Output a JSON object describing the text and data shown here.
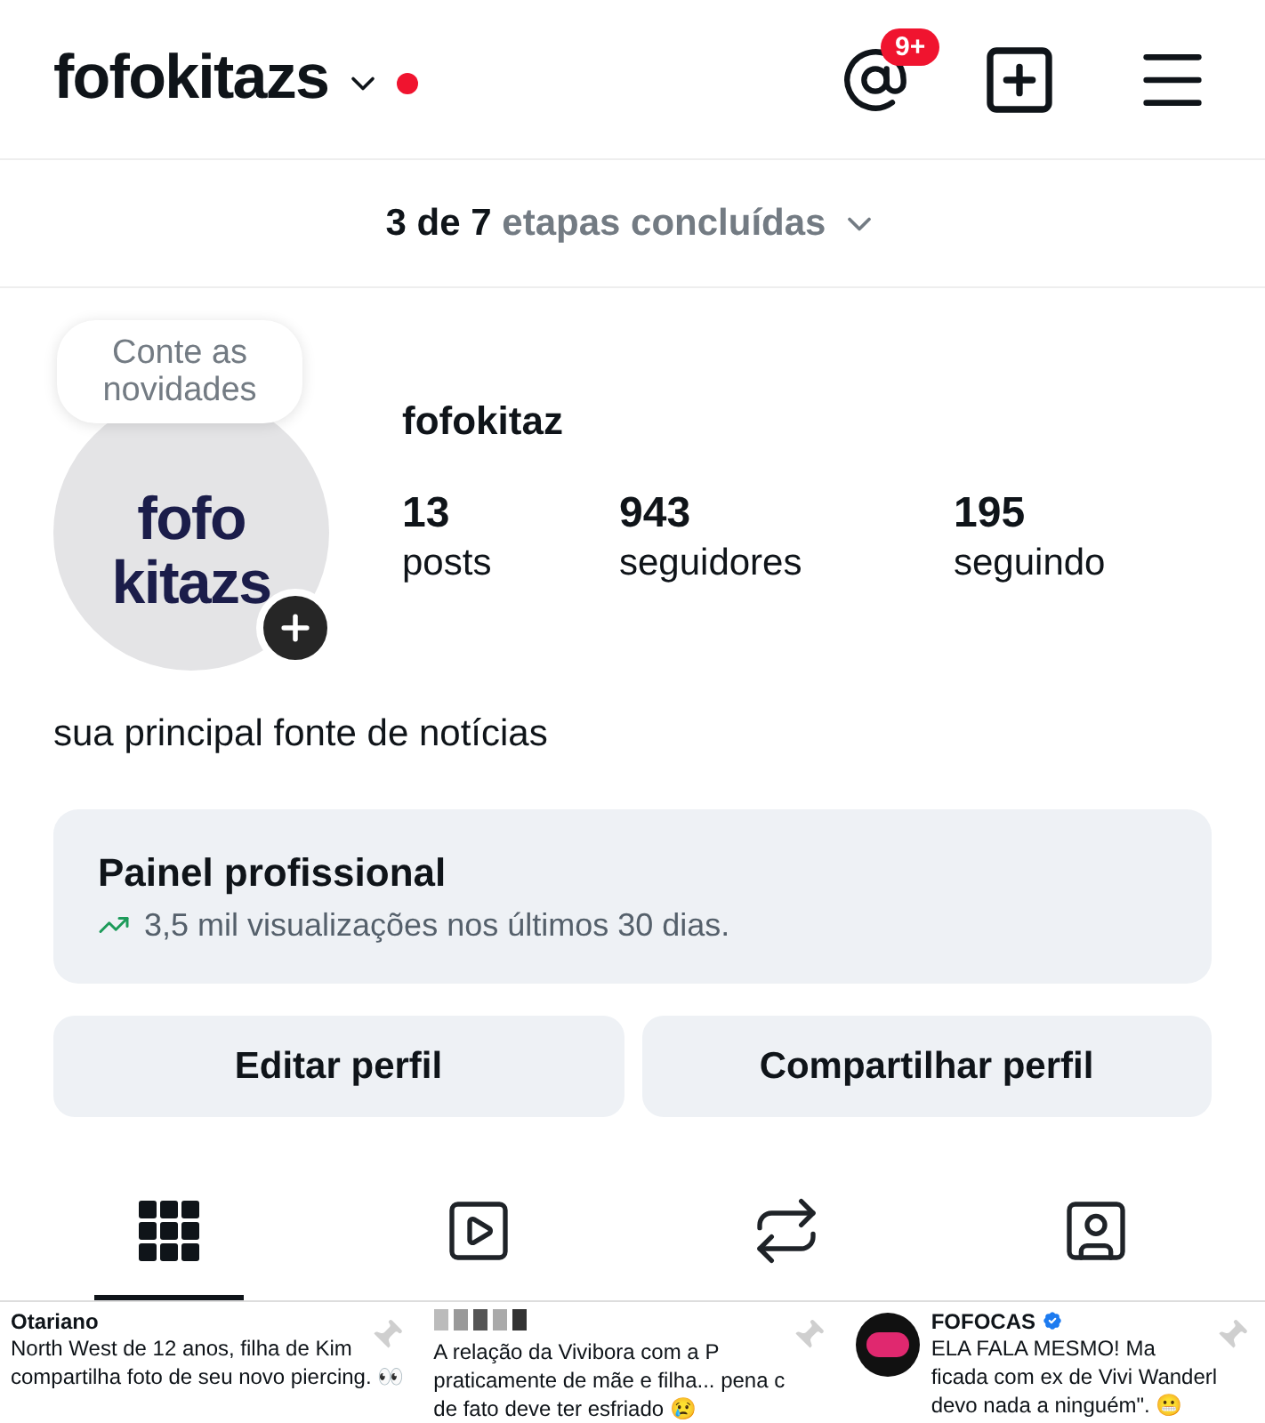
{
  "header": {
    "username": "fofokitazs",
    "new_activity_dot": true,
    "threads_badge": "9+"
  },
  "steps": {
    "done": "3 de 7",
    "rest": "etapas concluídas"
  },
  "profile": {
    "note": "Conte as novidades",
    "logo_lines": [
      "fofo",
      "kitazs"
    ],
    "name": "fofokitaz",
    "stats": [
      {
        "value": "13",
        "label": "posts"
      },
      {
        "value": "943",
        "label": "seguidores"
      },
      {
        "value": "195",
        "label": "seguindo"
      }
    ],
    "bio": "sua principal fonte de notícias"
  },
  "dashboard": {
    "title": "Painel profissional",
    "subtitle": "3,5 mil visualizações nos últimos 30 dias."
  },
  "buttons": [
    "Editar perfil",
    "Compartilhar perfil"
  ],
  "tabs": [
    {
      "kind": "grid",
      "selected": true
    },
    {
      "kind": "reels",
      "selected": false
    },
    {
      "kind": "reposts",
      "selected": false
    },
    {
      "kind": "tagged",
      "selected": false
    }
  ],
  "posts": [
    {
      "kind": "named",
      "author": "Otariano",
      "lines": [
        "North West de 12 anos, filha de Kim",
        "compartilha foto de seu novo piercing. 👀"
      ]
    },
    {
      "kind": "blurred",
      "lines": [
        "A relação da Vivibora com a P",
        "praticamente de mãe e filha... pena c",
        "de fato deve ter esfriado 😢"
      ]
    },
    {
      "kind": "verified",
      "author": "FOFOCAS",
      "lines": [
        "ELA FALA MESMO! Ma",
        "ficada com ex de Vivi Wanderl",
        "devo nada a ninguém\". 😬"
      ]
    }
  ]
}
